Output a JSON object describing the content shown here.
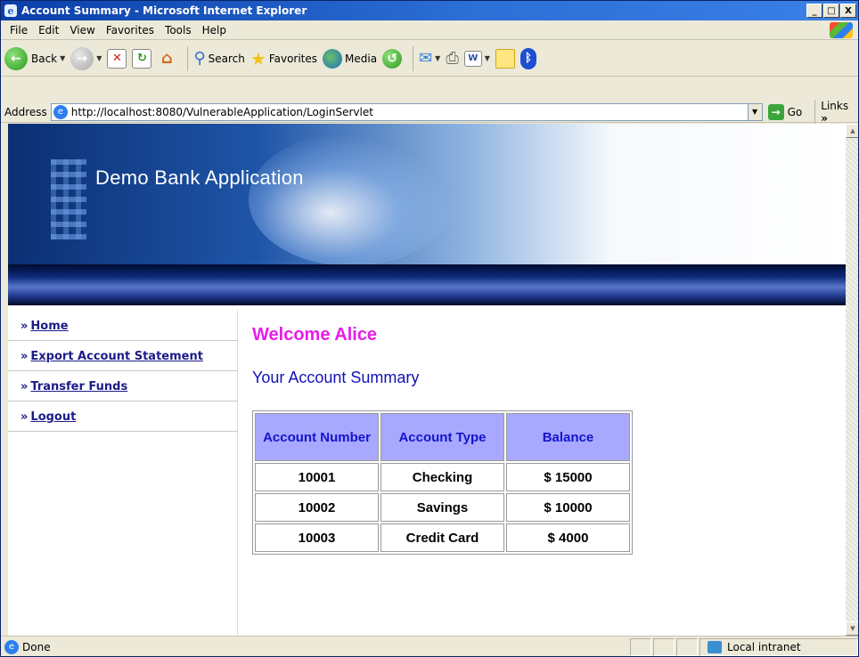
{
  "window": {
    "title": "Account Summary - Microsoft Internet Explorer",
    "icon": "ie-logo-icon",
    "controls": [
      "_",
      "□",
      "X"
    ]
  },
  "menu": [
    "File",
    "Edit",
    "View",
    "Favorites",
    "Tools",
    "Help"
  ],
  "toolbar": {
    "back": "Back",
    "search": "Search",
    "favorites": "Favorites",
    "media": "Media"
  },
  "address": {
    "label": "Address",
    "url": "http://localhost:8080/VulnerableApplication/LoginServlet",
    "go": "Go",
    "links": "Links"
  },
  "page": {
    "banner_title": "Demo Bank Application",
    "nav": [
      {
        "prefix": "»",
        "label": "Home"
      },
      {
        "prefix": "»",
        "label": "Export Account Statement"
      },
      {
        "prefix": "»",
        "label": "Transfer Funds"
      },
      {
        "prefix": "»",
        "label": "Logout"
      }
    ],
    "welcome": "Welcome Alice",
    "summary_title": "Your Account Summary",
    "table": {
      "headers": [
        "Account Number",
        "Account Type",
        "Balance"
      ],
      "rows": [
        [
          "10001",
          "Checking",
          "$ 15000"
        ],
        [
          "10002",
          "Savings",
          "$ 10000"
        ],
        [
          "10003",
          "Credit Card",
          "$ 4000"
        ]
      ]
    }
  },
  "status": {
    "text": "Done",
    "zone": "Local intranet"
  }
}
